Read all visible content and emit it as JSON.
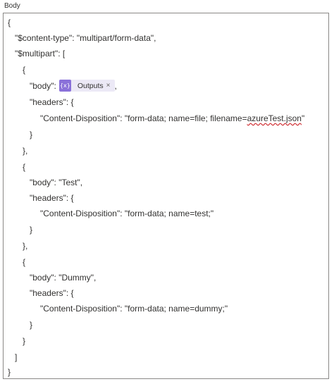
{
  "field": {
    "label": "Body"
  },
  "token": {
    "icon_name": "expression-icon",
    "icon_glyph": "{x}",
    "label": "Outputs",
    "close_glyph": "×"
  },
  "json_text": {
    "l01": "{",
    "l02": "\"$content-type\": \"multipart/form-data\",",
    "l03": "\"$multipart\": [",
    "l04": "{",
    "l05_key": "\"body\":",
    "l05_after": ",",
    "l06": "\"headers\": {",
    "l07_before": "\"Content-Disposition\": \"form-data; name=file; filename=",
    "l07_filename": "azureTest.json",
    "l07_after": "\"",
    "l08": "}",
    "l09": "},",
    "l10": "{",
    "l11": "\"body\": \"Test\",",
    "l12": "\"headers\": {",
    "l13": "\"Content-Disposition\": \"form-data; name=test;\"",
    "l14": "}",
    "l15": "},",
    "l16": "{",
    "l17": "\"body\": \"Dummy\",",
    "l18": "\"headers\": {",
    "l19": "\"Content-Disposition\": \"form-data; name=dummy;\"",
    "l20": "}",
    "l21": "}",
    "l22": "]",
    "l23": "}"
  }
}
